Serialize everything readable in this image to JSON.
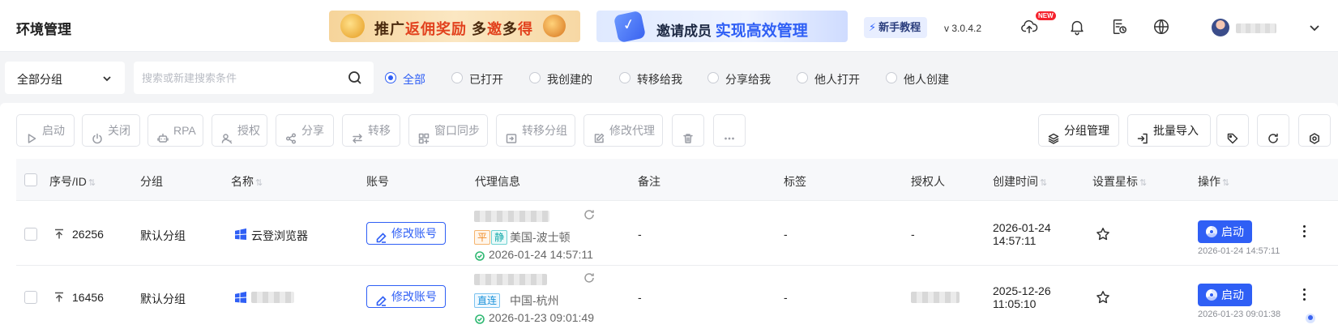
{
  "header": {
    "app_title": "环境管理",
    "banner_promo": {
      "part1": "推广",
      "part2": "返佣奖励",
      "part3": " 多",
      "part4": "邀",
      "part5": "多",
      "part6": "得"
    },
    "banner_invite": {
      "part1": "邀请成员 ",
      "part2": "实现高效管理"
    },
    "tutorial_label": "新手教程",
    "version": "v 3.0.4.2",
    "new_badge": "NEW"
  },
  "filters": {
    "group_select_value": "全部分组",
    "search_placeholder": "搜索或新建搜索条件",
    "search_value": "",
    "radios": [
      {
        "label": "全部",
        "selected": true
      },
      {
        "label": "已打开",
        "selected": false
      },
      {
        "label": "我创建的",
        "selected": false
      },
      {
        "label": "转移给我",
        "selected": false
      },
      {
        "label": "分享给我",
        "selected": false
      },
      {
        "label": "他人打开",
        "selected": false
      },
      {
        "label": "他人创建",
        "selected": false
      }
    ]
  },
  "toolbar": {
    "start": "启动",
    "close": "关闭",
    "rpa": "RPA",
    "authorize": "授权",
    "share": "分享",
    "transfer": "转移",
    "window_sync": "窗口同步",
    "transfer_group": "转移分组",
    "edit_proxy": "修改代理",
    "group_manage": "分组管理",
    "batch_import": "批量导入"
  },
  "table": {
    "headers": {
      "id": "序号/ID",
      "group": "分组",
      "name": "名称",
      "account": "账号",
      "proxy": "代理信息",
      "remark": "备注",
      "tags": "标签",
      "grantee": "授权人",
      "created": "创建时间",
      "star": "设置星标",
      "action": "操作"
    },
    "rows": [
      {
        "id": "26256",
        "group": "默认分组",
        "name": "云登浏览器",
        "account_btn": "修改账号",
        "proxy_tags": [
          "平",
          "静"
        ],
        "proxy_location": "美国-波士顿",
        "proxy_checked": "2026-01-24 14:57:11",
        "remark": "-",
        "tags": "-",
        "grantee": "-",
        "created_date": "2026-01-24",
        "created_time": "14:57:11",
        "start_btn": "启动",
        "last_open": "2026-01-24 14:57:11"
      },
      {
        "id": "16456",
        "group": "默认分组",
        "name": "",
        "account_btn": "修改账号",
        "proxy_tags": [
          "直连"
        ],
        "proxy_location": "中国-杭州",
        "proxy_checked": "2026-01-23 09:01:49",
        "remark": "-",
        "tags": "-",
        "grantee": "",
        "created_date": "2025-12-26",
        "created_time": "11:05:10",
        "start_btn": "启动",
        "last_open": "2026-01-23 09:01:38"
      }
    ]
  },
  "colors": {
    "accent": "#2f5ff5",
    "success": "#2eb872",
    "badge_red": "#f5222d"
  }
}
